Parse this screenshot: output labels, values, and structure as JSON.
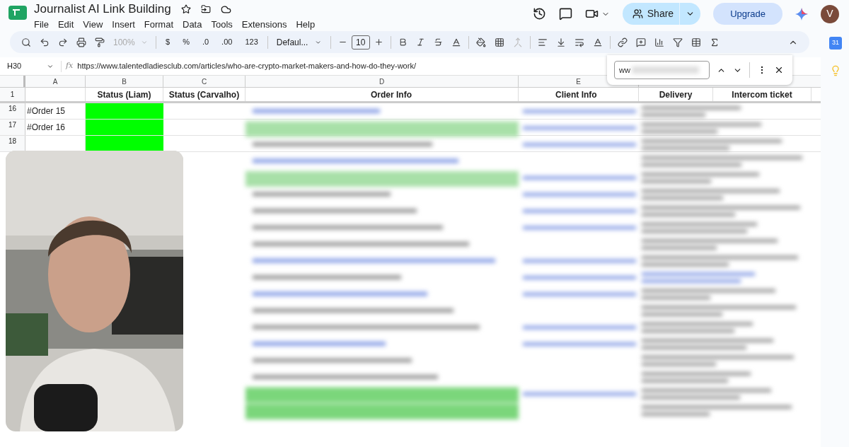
{
  "document": {
    "title": "Journalist AI Link Building"
  },
  "menu": [
    "File",
    "Edit",
    "View",
    "Insert",
    "Format",
    "Data",
    "Tools",
    "Extensions",
    "Help"
  ],
  "header_actions": {
    "share": "Share",
    "upgrade": "Upgrade",
    "avatar": "V"
  },
  "toolbar": {
    "zoom": "100%",
    "currency": "$",
    "percent": "%",
    "decrease_decimals": ".0",
    "increase_decimals": ".00",
    "number_format": "123",
    "font": "Defaul...",
    "font_size": "10"
  },
  "formula_bar": {
    "cell": "H30",
    "fx_label": "fx",
    "formula": "https://www.talentedladiesclub.com/articles/who-are-crypto-market-makers-and-how-do-they-work/"
  },
  "columns": [
    "A",
    "B",
    "C",
    "D",
    "E"
  ],
  "header_row": {
    "number": "1",
    "cells": [
      "",
      "Status (Liam)",
      "Status (Carvalho)",
      "Order Info",
      "Client Info",
      "Delivery",
      "Intercom ticket"
    ]
  },
  "rows": [
    {
      "number": "16",
      "order": "#Order 15",
      "color": "#00ff00"
    },
    {
      "number": "17",
      "order": "#Order 16",
      "color": "#00ff00"
    },
    {
      "number": "18",
      "color": "#00ff00"
    }
  ],
  "find_panel": {
    "query": "ww"
  },
  "side_panel": {
    "calendar": "31"
  }
}
